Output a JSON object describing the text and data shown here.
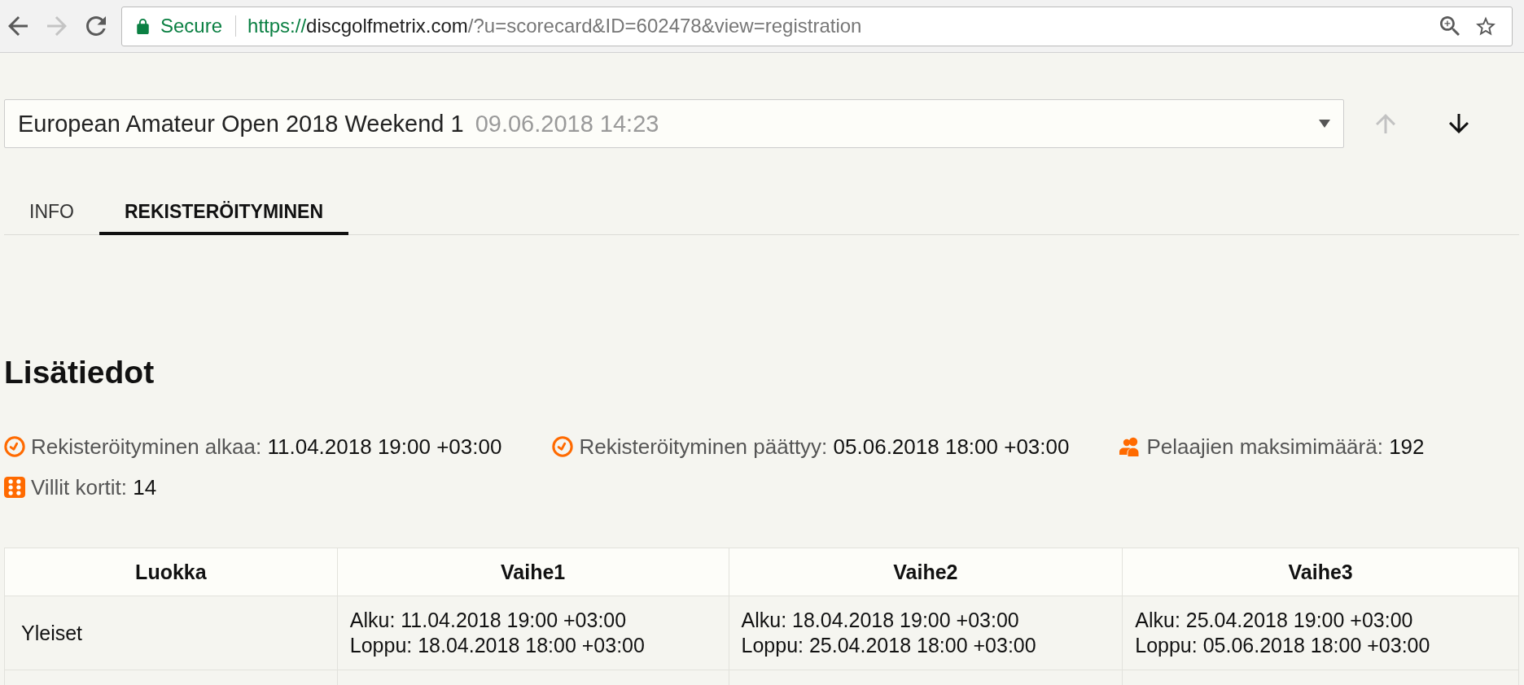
{
  "browser": {
    "nav_buttons": [
      {
        "kind": "back",
        "disabled": false
      },
      {
        "kind": "forward",
        "disabled": true
      },
      {
        "kind": "reload",
        "disabled": false
      }
    ],
    "security_label": "Secure",
    "url": {
      "scheme": "https://",
      "host": "discgolfmetrix.com",
      "path": "/?u=scorecard&ID=602478&view=registration"
    }
  },
  "event_select": {
    "title": "European Amateur Open 2018 Weekend 1",
    "date": "09.06.2018 14:23"
  },
  "round_nav": [
    {
      "kind": "up",
      "disabled": true
    },
    {
      "kind": "down",
      "disabled": false
    }
  ],
  "tabs": [
    {
      "label": "INFO",
      "selected": false
    },
    {
      "label": "REKISTERÖITYMINEN",
      "selected": true
    }
  ],
  "section_title": "Lisätiedot",
  "details": [
    {
      "kind": "clock",
      "label": "Rekisteröityminen alkaa:",
      "value": "11.04.2018 19:00 +03:00"
    },
    {
      "kind": "clock",
      "label": "Rekisteröityminen päättyy:",
      "value": "05.06.2018 18:00 +03:00"
    },
    {
      "kind": "players",
      "label": "Pelaajien maksimimäärä:",
      "value": "192"
    },
    {
      "kind": "wildcards",
      "label": "Villit kortit:",
      "value": "14"
    }
  ],
  "table": {
    "columns": [
      "Luokka",
      "Vaihe1",
      "Vaihe2",
      "Vaihe3"
    ],
    "rows": [
      {
        "cells": [
          [
            "Yleiset"
          ],
          [
            "Alku: 11.04.2018 19:00 +03:00",
            "Loppu: 18.04.2018 18:00 +03:00"
          ],
          [
            "Alku: 18.04.2018 19:00 +03:00",
            "Loppu: 25.04.2018 18:00 +03:00"
          ],
          [
            "Alku: 25.04.2018 19:00 +03:00",
            "Loppu: 05.06.2018 18:00 +03:00"
          ]
        ]
      }
    ]
  }
}
